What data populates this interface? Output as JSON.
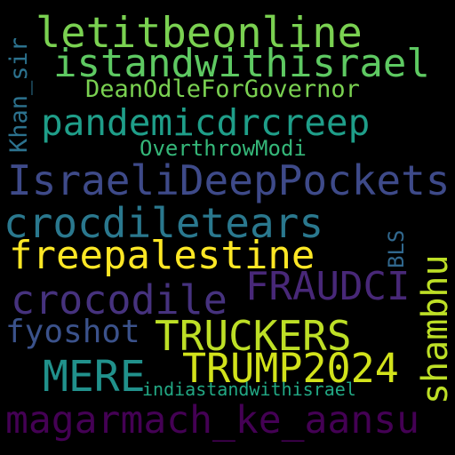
{
  "words": [
    {
      "text": "letitbeonline",
      "color": "#7ad151"
    },
    {
      "text": "istandwithisrael",
      "color": "#5ec962"
    },
    {
      "text": "DeanOdleForGovernor",
      "color": "#7ad151"
    },
    {
      "text": "pandemicdrcreep",
      "color": "#1f9e89"
    },
    {
      "text": "OverthrowModi",
      "color": "#35b779"
    },
    {
      "text": "IsraeliDeepPockets",
      "color": "#3e4a89"
    },
    {
      "text": "crocdiletears",
      "color": "#2a788e"
    },
    {
      "text": "freepalestine",
      "color": "#fde725"
    },
    {
      "text": "crocodile",
      "color": "#46327e"
    },
    {
      "text": "FRAUDCI",
      "color": "#482878"
    },
    {
      "text": "fyoshot",
      "color": "#3b528b"
    },
    {
      "text": "TRUCKERS",
      "color": "#bddf26"
    },
    {
      "text": "MERE",
      "color": "#21918c"
    },
    {
      "text": "TRUMP2024",
      "color": "#d2e21b"
    },
    {
      "text": "indiastandwithisrael",
      "color": "#22a884"
    },
    {
      "text": "magarmach_ke_aansu",
      "color": "#440154"
    },
    {
      "text": "Khan_sir",
      "color": "#2c728e"
    },
    {
      "text": "BLS",
      "color": "#31688e"
    },
    {
      "text": "shambhu",
      "color": "#bddf26"
    }
  ]
}
